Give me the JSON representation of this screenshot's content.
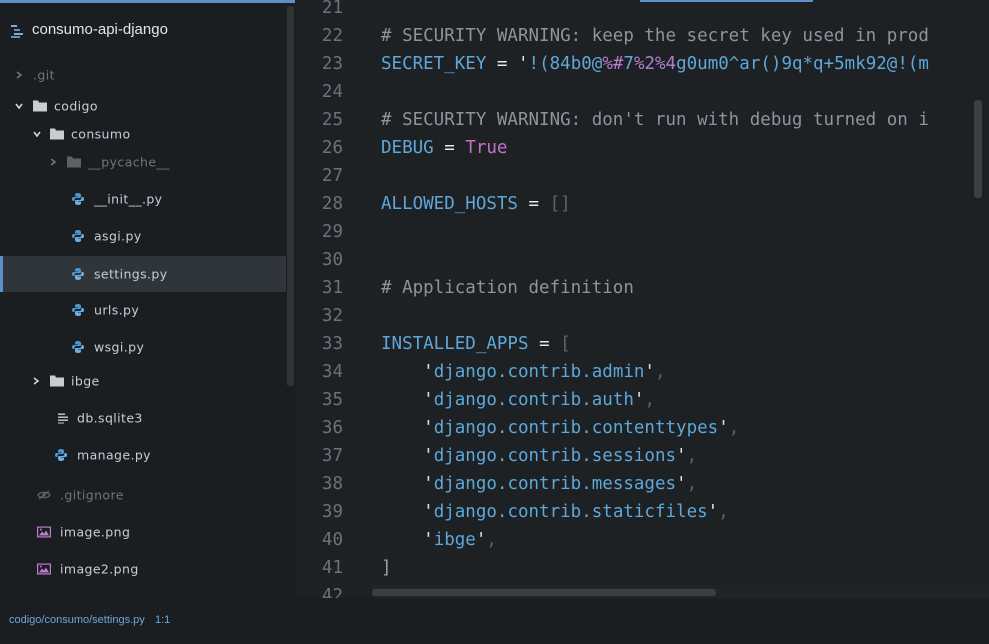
{
  "sidebar": {
    "project_name": "consumo-api-django",
    "items": [
      {
        "label": ".git",
        "type": "folder-collapsed",
        "dim": true
      },
      {
        "label": "codigo",
        "type": "folder-open"
      },
      {
        "label": "consumo",
        "type": "folder-open"
      },
      {
        "label": "__pycache__",
        "type": "folder-collapsed",
        "dim": true
      },
      {
        "label": "__init__.py",
        "type": "python-file"
      },
      {
        "label": "asgi.py",
        "type": "python-file"
      },
      {
        "label": "settings.py",
        "type": "python-file",
        "selected": true
      },
      {
        "label": "urls.py",
        "type": "python-file"
      },
      {
        "label": "wsgi.py",
        "type": "python-file"
      },
      {
        "label": "ibge",
        "type": "folder-collapsed"
      },
      {
        "label": "db.sqlite3",
        "type": "text-file"
      },
      {
        "label": "manage.py",
        "type": "python-file"
      },
      {
        "label": ".gitignore",
        "type": "ignored-file",
        "dim": true
      },
      {
        "label": "image.png",
        "type": "image-file"
      },
      {
        "label": "image2.png",
        "type": "image-file"
      }
    ]
  },
  "editor": {
    "lines": [
      {
        "n": "21",
        "text": ""
      },
      {
        "n": "22",
        "text": "# SECURITY WARNING: keep the secret key used in prod"
      },
      {
        "n": "23",
        "text": "SECRET_KEY = '!(84b0@%#7%2%4g0um0^ar()9q*q+5mk92@!(m"
      },
      {
        "n": "24",
        "text": ""
      },
      {
        "n": "25",
        "text": "# SECURITY WARNING: don't run with debug turned on i"
      },
      {
        "n": "26",
        "text": "DEBUG = True"
      },
      {
        "n": "27",
        "text": ""
      },
      {
        "n": "28",
        "text": "ALLOWED_HOSTS = []"
      },
      {
        "n": "29",
        "text": ""
      },
      {
        "n": "30",
        "text": ""
      },
      {
        "n": "31",
        "text": "# Application definition"
      },
      {
        "n": "32",
        "text": ""
      },
      {
        "n": "33",
        "text": "INSTALLED_APPS = ["
      },
      {
        "n": "34",
        "text": "    'django.contrib.admin',"
      },
      {
        "n": "35",
        "text": "    'django.contrib.auth',"
      },
      {
        "n": "36",
        "text": "    'django.contrib.contenttypes',"
      },
      {
        "n": "37",
        "text": "    'django.contrib.sessions',"
      },
      {
        "n": "38",
        "text": "    'django.contrib.messages',"
      },
      {
        "n": "39",
        "text": "    'django.contrib.staticfiles',"
      },
      {
        "n": "40",
        "text": "    'ibge',"
      },
      {
        "n": "41",
        "text": "]"
      },
      {
        "n": "42",
        "text": ""
      }
    ]
  },
  "statusbar": {
    "file_path": "codigo/consumo/settings.py",
    "cursor_position": "1:1"
  },
  "colors": {
    "accent": "#5d8fc9",
    "background": "#1d2124",
    "sidebar_background": "#1a1e21",
    "python_icon": "#4e96cf"
  }
}
